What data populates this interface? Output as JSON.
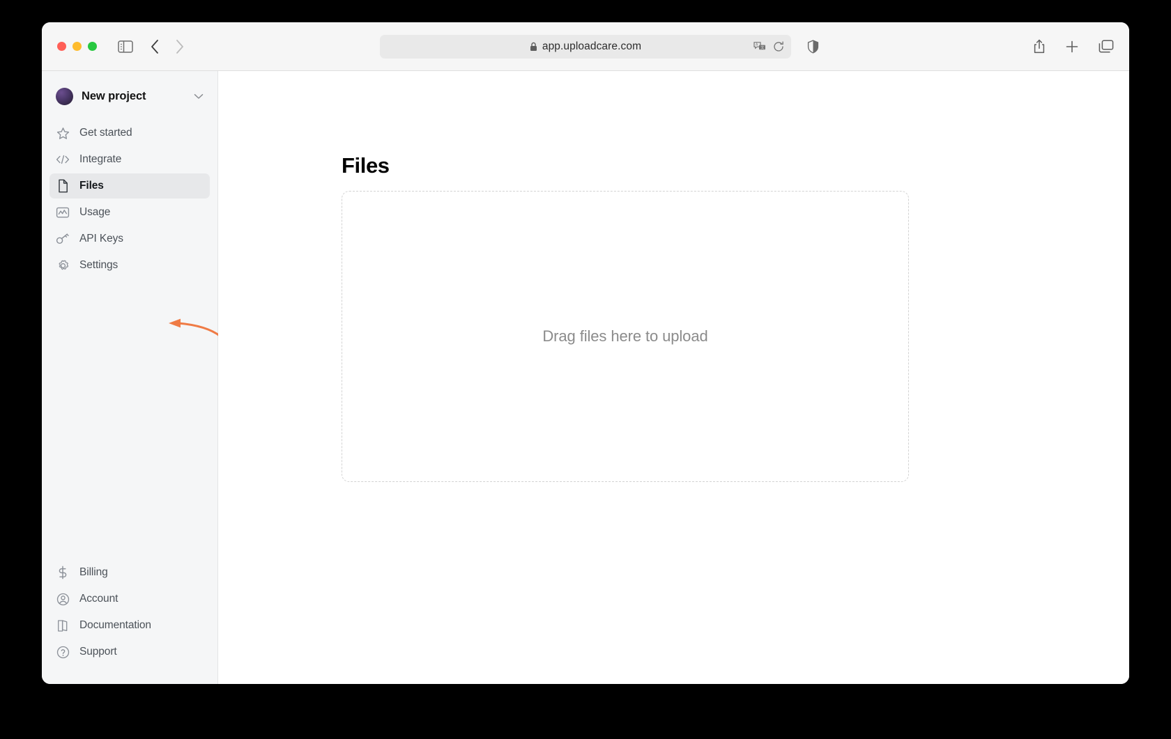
{
  "browser": {
    "url": "app.uploadcare.com",
    "lock_icon": "lock-icon",
    "window_controls": [
      "close",
      "minimize",
      "maximize"
    ],
    "toolbar_icons": {
      "sidebar_toggle": "sidebar-toggle-icon",
      "back": "chevron-left-icon",
      "forward": "chevron-right-icon",
      "translate": "translate-icon",
      "reload": "reload-icon",
      "shield": "shield-icon",
      "share": "share-icon",
      "new_tab": "plus-icon",
      "tab_overview": "tab-overview-icon"
    }
  },
  "sidebar": {
    "project": {
      "name": "New project",
      "avatar_color": "#4a3768",
      "chevron_icon": "chevron-down-icon"
    },
    "primary_items": [
      {
        "label": "Get started",
        "icon": "star-icon",
        "active": false
      },
      {
        "label": "Integrate",
        "icon": "code-icon",
        "active": false
      },
      {
        "label": "Files",
        "icon": "file-icon",
        "active": true
      },
      {
        "label": "Usage",
        "icon": "chart-icon",
        "active": false
      },
      {
        "label": "API Keys",
        "icon": "key-icon",
        "active": false
      },
      {
        "label": "Settings",
        "icon": "gear-icon",
        "active": false
      }
    ],
    "secondary_items": [
      {
        "label": "Billing",
        "icon": "dollar-icon",
        "active": false
      },
      {
        "label": "Account",
        "icon": "user-circle-icon",
        "active": false
      },
      {
        "label": "Documentation",
        "icon": "book-icon",
        "active": false
      },
      {
        "label": "Support",
        "icon": "question-circle-icon",
        "active": false
      }
    ]
  },
  "main": {
    "title": "Files",
    "dropzone_text": "Drag files here to upload"
  },
  "annotation": {
    "arrow_color": "#ef7b45",
    "points_to": "API Keys"
  }
}
